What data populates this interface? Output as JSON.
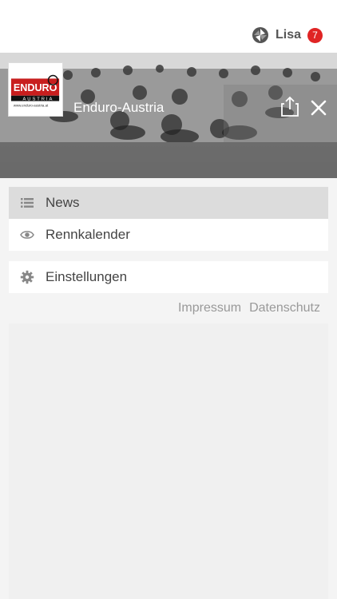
{
  "header": {
    "user_name": "Lisa",
    "notification_count": "7",
    "badge_color": "#e02424",
    "user_icon": "user-logo-icon"
  },
  "hero": {
    "title": "Enduro-Austria",
    "share_icon": "share-icon",
    "close_icon": "close-icon",
    "logo": {
      "brand": "ENDURO",
      "sub": "AUSTRIA",
      "url": "www.enduro-austria.at"
    }
  },
  "menu": {
    "items": [
      {
        "label": "News",
        "icon": "list-icon",
        "active": true
      },
      {
        "label": "Rennkalender",
        "icon": "eye-icon",
        "active": false
      }
    ],
    "settings": {
      "label": "Einstellungen",
      "icon": "gear-icon"
    }
  },
  "footer": {
    "impressum": "Impressum",
    "datenschutz": "Datenschutz"
  }
}
